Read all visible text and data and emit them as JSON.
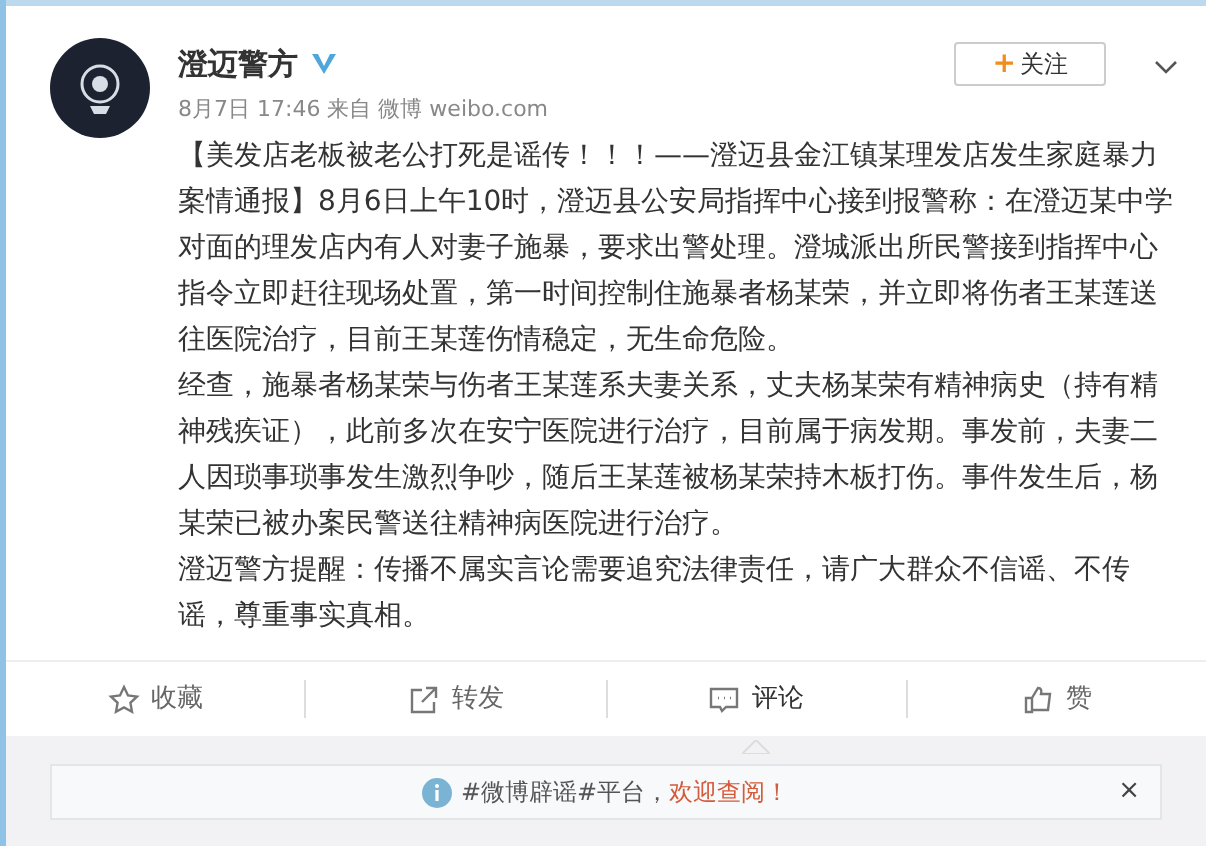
{
  "post": {
    "author": "澄迈警方",
    "verified": true,
    "meta": "8月7日 17:46 来自 微博 weibo.com",
    "follow_button": {
      "icon": "+",
      "label": "关注"
    },
    "paragraphs": [
      "【美发店老板被老公打死是谣传！！！——澄迈县金江镇某理发店发生家庭暴力案情通报】8月6日上午10时，澄迈县公安局指挥中心接到报警称：在澄迈某中学对面的理发店内有人对妻子施暴，要求出警处理。澄城派出所民警接到指挥中心指令立即赶往现场处置，第一时间控制住施暴者杨某荣，并立即将伤者王某莲送往医院治疗，目前王某莲伤情稳定，无生命危险。",
      "经查，施暴者杨某荣与伤者王某莲系夫妻关系，丈夫杨某荣有精神病史（持有精神残疾证），此前多次在安宁医院进行治疗，目前属于病发期。事发前，夫妻二人因琐事琐事发生激烈争吵，随后王某莲被杨某荣持木板打伤。事件发生后，杨某荣已被办案民警送往精神病医院进行治疗。",
      "澄迈警方提醒：传播不属实言论需要追究法律责任，请广大群众不信谣、不传谣，尊重事实真相。"
    ]
  },
  "actions": [
    {
      "kind": "favorite",
      "label": "收藏",
      "selected": false
    },
    {
      "kind": "repost",
      "label": "转发",
      "selected": false
    },
    {
      "kind": "comment",
      "label": "评论",
      "selected": true
    },
    {
      "kind": "like",
      "label": "赞",
      "selected": false
    }
  ],
  "notice": {
    "text": "#微博辟谣#平台，",
    "link": "欢迎查阅！",
    "close": "×"
  }
}
